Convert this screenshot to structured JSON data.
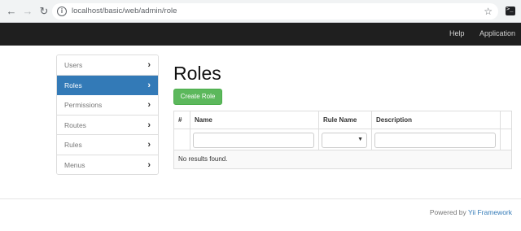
{
  "browser": {
    "url": "localhost/basic/web/admin/role",
    "back_icon": "arrow-left",
    "forward_icon": "arrow-right",
    "reload_icon": "reload",
    "info_icon": "info",
    "star_icon": "star",
    "extension_icon": "terminal"
  },
  "navbar": {
    "links": [
      "Help",
      "Application"
    ]
  },
  "sidebar": {
    "items": [
      {
        "label": "Users",
        "active": false
      },
      {
        "label": "Roles",
        "active": true
      },
      {
        "label": "Permissions",
        "active": false
      },
      {
        "label": "Routes",
        "active": false
      },
      {
        "label": "Rules",
        "active": false
      },
      {
        "label": "Menus",
        "active": false
      }
    ],
    "active_color": "#337ab7"
  },
  "main": {
    "title": "Roles",
    "create_button": "Create Role",
    "create_button_color": "#5cb85c",
    "table": {
      "columns": [
        "#",
        "Name",
        "Rule Name",
        "Description",
        ""
      ],
      "empty_text": "No results found."
    }
  },
  "footer": {
    "prefix": "Powered by ",
    "link": "Yii Framework"
  }
}
